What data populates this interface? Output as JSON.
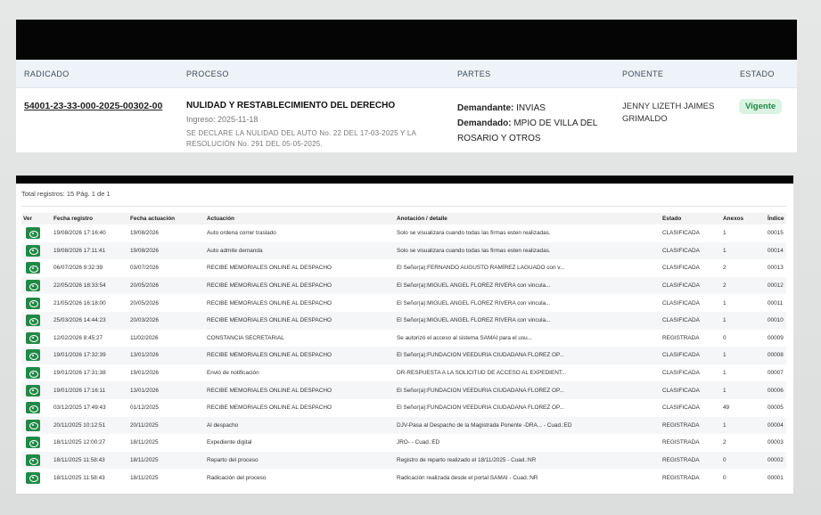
{
  "summary": {
    "headers": {
      "radicado": "RADICADO",
      "proceso": "PROCESO",
      "partes": "PARTES",
      "ponente": "PONENTE",
      "estado": "ESTADO"
    },
    "radicado": "54001-23-33-000-2025-00302-00",
    "proceso_title": "NULIDAD Y RESTABLECIMIENTO DEL DERECHO",
    "ingreso": "Ingreso: 2025-11-18",
    "proceso_desc": "SE DECLARE LA NULIDAD DEL AUTO No. 22 DEL 17-03-2025 Y LA RESOLUCIÓN No. 291 DEL 05-05-2025.",
    "demandante_label": "Demandante:",
    "demandante": "INVIAS",
    "demandado_label": "Demandado:",
    "demandado": "MPIO DE VILLA DEL ROSARIO Y OTROS",
    "ponente": "JENNY LIZETH JAIMES GRIMALDO",
    "estado": "Vigente"
  },
  "actuaciones": {
    "total_text": "Total registros: 15  Pág. 1 de 1",
    "columns": [
      "Ver",
      "Fecha registro",
      "Fecha actuación",
      "Actuación",
      "Anotación / detalle",
      "Estado",
      "Anexos",
      "Índice"
    ],
    "rows": [
      [
        "19/08/2026 17:16:40",
        "19/08/2026",
        "Auto ordena correr traslado",
        "Solo se visualizara cuando todas las firmas esten realizadas.",
        "CLASIFICADA",
        "1",
        "00015"
      ],
      [
        "19/08/2026 17:11:41",
        "19/08/2026",
        "Auto admite demanda",
        "Solo se visualizara cuando todas las firmas esten realizadas.",
        "CLASIFICADA",
        "1",
        "00014"
      ],
      [
        "06/07/2026 9:32:39",
        "03/07/2026",
        "RECIBE MEMORIALES ONLINE AL DESPACHO",
        "El Señor(a):FERNANDO AUGUSTO RAMÍREZ LAGUADO con v...",
        "CLASIFICADA",
        "2",
        "00013"
      ],
      [
        "22/05/2026 18:33:54",
        "20/05/2026",
        "RECIBE MEMORIALES ONLINE AL DESPACHO",
        "El Señor(a):MIGUEL ANGEL FLOREZ RIVERA con vincula...",
        "CLASIFICADA",
        "2",
        "00012"
      ],
      [
        "21/05/2026 16:18:00",
        "20/05/2026",
        "RECIBE MEMORIALES ONLINE AL DESPACHO",
        "El Señor(a):MIGUEL ANGEL FLOREZ RIVERA con vincula...",
        "CLASIFICADA",
        "1",
        "00011"
      ],
      [
        "25/03/2026 14:44:23",
        "20/03/2026",
        "RECIBE MEMORIALES ONLINE AL DESPACHO",
        "El Señor(a):MIGUEL ANGEL FLOREZ RIVERA con vincula...",
        "CLASIFICADA",
        "1",
        "00010"
      ],
      [
        "12/02/2026 8:45:27",
        "11/02/2026",
        "CONSTANCIA SECRETARIAL",
        "Se autorizó el acceso al sistema SAMAI para el usu...",
        "REGISTRADA",
        "0",
        "00009"
      ],
      [
        "19/01/2026 17:32:39",
        "13/01/2026",
        "RECIBE MEMORIALES ONLINE AL DESPACHO",
        "El Señor(a):FUNDACION VEEDURIA CIUDADANA FLOREZ OP...",
        "CLASIFICADA",
        "1",
        "00008"
      ],
      [
        "19/01/2026 17:31:38",
        "19/01/2026",
        "Envió de notificación",
        "DR-RESPUESTA A LA SOLICITUD DE ACCESO AL EXPEDIENT...",
        "CLASIFICADA",
        "1",
        "00007"
      ],
      [
        "19/01/2026 17:16:11",
        "13/01/2026",
        "RECIBE MEMORIALES ONLINE AL DESPACHO",
        "El Señor(a):FUNDACION VEEDURIA CIUDADANA FLOREZ OP...",
        "CLASIFICADA",
        "1",
        "00006"
      ],
      [
        "03/12/2025 17:49:43",
        "01/12/2025",
        "RECIBE MEMORIALES ONLINE AL DESPACHO",
        "El Señor(a):FUNDACION VEEDURIA CIUDADANA FLOREZ OP...",
        "CLASIFICADA",
        "49",
        "00005"
      ],
      [
        "20/11/2025 10:12:51",
        "20/11/2025",
        "Al despacho",
        "DJV-Pasa al Despacho de la Magistrada Ponente -DRA... - Cuad.:ED",
        "REGISTRADA",
        "1",
        "00004"
      ],
      [
        "18/11/2025 12:00:27",
        "18/11/2025",
        "Expediente digital",
        "JRO- - Cuad.:ED",
        "REGISTRADA",
        "2",
        "00003"
      ],
      [
        "18/11/2025 11:58:43",
        "18/11/2025",
        "Reparto del proceso",
        "Registro de reparto realizado el 18/11/2025 - Cuad.:NR",
        "REGISTRADA",
        "0",
        "00002"
      ],
      [
        "18/11/2025 11:58:43",
        "18/11/2025",
        "Radicación del proceso",
        "Radicación realizada desde el portal SAMAI - Cuad.:NR",
        "REGISTRADA",
        "0",
        "00001"
      ]
    ]
  },
  "colors": {
    "accent_green": "#1f8a45",
    "badge_bg": "#dbf3e2",
    "header_bg": "#eef3f9"
  },
  "icons": {
    "ver_button": "eye-icon"
  }
}
